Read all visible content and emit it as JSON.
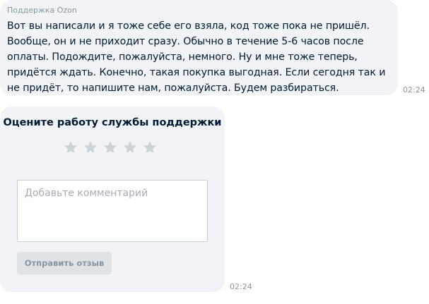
{
  "chat": {
    "message": {
      "sender": "Поддержка Ozon",
      "text": "Вот вы написали и я тоже себе его взяла, код тоже пока не пришёл. Вообще, он и не приходит сразу. Обычно в течение 5-6 часов после оплаты. Подождите, пожалуйста, немного. Ну и мне тоже теперь, придётся ждать. Конечно, такая покупка выгодная. Если сегодня так и не придёт, то напишите нам, пожалуйста. Будем разбираться.",
      "time": "02:24"
    },
    "rating_card": {
      "title": "Оцените работу службы поддержки",
      "stars_total": 5,
      "stars_selected": 0,
      "star_icon": "star-icon",
      "star_color": "#cdd2d8",
      "comment_placeholder": "Добавьте комментарий",
      "comment_value": "",
      "submit_label": "Отправить отзыв",
      "time": "02:24"
    }
  },
  "colors": {
    "bubble_bg": "#f1f3f6",
    "text_primary": "#001a34",
    "text_secondary": "#8a949e",
    "button_bg": "#dfe3e8"
  }
}
